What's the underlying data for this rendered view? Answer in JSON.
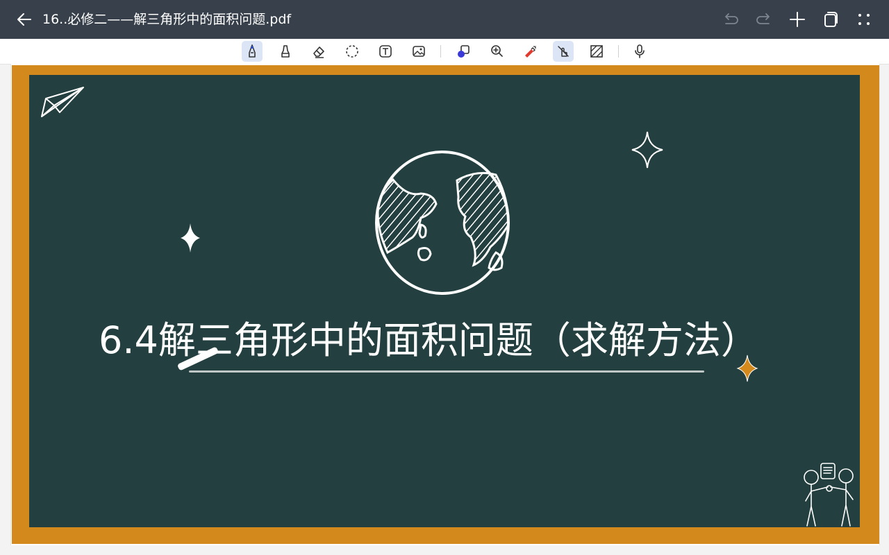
{
  "window": {
    "title": "16..必修二——解三角形中的面积问题.pdf"
  },
  "toolbar": {
    "tools": [
      {
        "name": "pen",
        "active": true
      },
      {
        "name": "marker",
        "active": false
      },
      {
        "name": "eraser",
        "active": false
      },
      {
        "name": "lasso",
        "active": false
      },
      {
        "name": "text-box",
        "active": false
      },
      {
        "name": "image",
        "active": false
      },
      {
        "name": "shapes",
        "active": false
      },
      {
        "name": "zoom",
        "active": false
      },
      {
        "name": "laser-pointer",
        "active": false
      },
      {
        "name": "hand-draw-toggle",
        "active": true
      },
      {
        "name": "pattern",
        "active": false
      },
      {
        "name": "microphone",
        "active": false
      }
    ]
  },
  "slide": {
    "title": "6.4解三角形中的面积问题（求解方法）",
    "board_color": "#233f3f",
    "frame_color": "#d4891c",
    "accent_star_color": "#d4891c"
  },
  "colors": {
    "header_bg": "#38414b",
    "toolbar_bg": "#ffffff",
    "active_tool_bg": "#dbe5f5"
  }
}
